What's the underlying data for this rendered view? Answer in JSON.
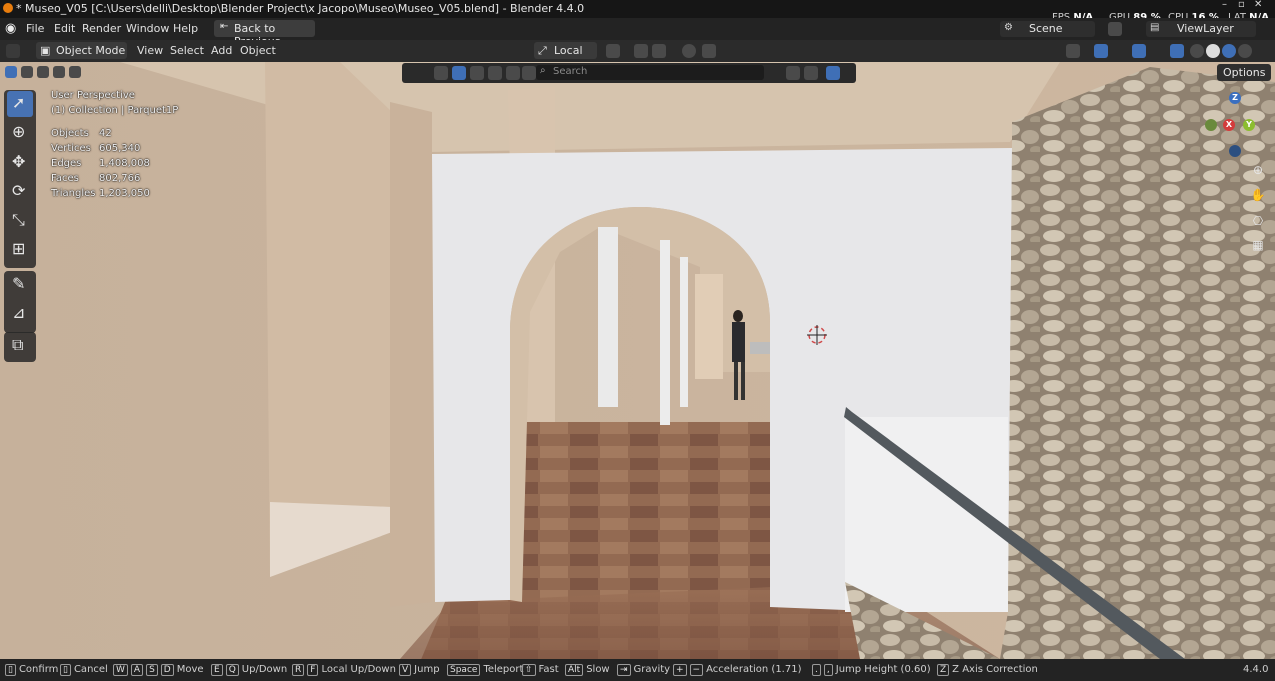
{
  "window": {
    "title": "* Museo_V05 [C:\\Users\\delli\\Desktop\\Blender Project\\x Jacopo\\Museo\\Museo_V05.blend] - Blender 4.4.0",
    "fps_label": "FPS",
    "fps_value": "N/A",
    "gpu_label": "GPU",
    "gpu_value": "89 %",
    "cpu_label": "CPU",
    "cpu_value": "16 %",
    "lat_label": "LAT",
    "lat_value": "N/A"
  },
  "menu": {
    "items": [
      "File",
      "Edit",
      "Render",
      "Window",
      "Help"
    ],
    "back_button": "Back to Previous",
    "scene": "Scene",
    "view_layer": "ViewLayer"
  },
  "header": {
    "mode": "Object Mode",
    "items": [
      "View",
      "Select",
      "Add",
      "Object"
    ],
    "transform_orientation": "Local",
    "search_placeholder": "Search",
    "options": "Options"
  },
  "viewport": {
    "perspective": "User Perspective",
    "collection": "(1) Collection | Parquet1P",
    "stats": [
      {
        "label": "Objects",
        "value": "42"
      },
      {
        "label": "Vertices",
        "value": "605,340"
      },
      {
        "label": "Edges",
        "value": "1,408,008"
      },
      {
        "label": "Faces",
        "value": "802,766"
      },
      {
        "label": "Triangles",
        "value": "1,203,050"
      }
    ],
    "gizmo": {
      "z": "Z",
      "x": "X",
      "y": "Y"
    }
  },
  "status": {
    "confirm": "Confirm",
    "cancel": "Cancel",
    "move": "Move",
    "updown": "Up/Down",
    "local_updown": "Local Up/Down",
    "jump": "Jump",
    "teleport": "Teleport",
    "fast": "Fast",
    "slow": "Slow",
    "gravity": "Gravity",
    "acceleration": "Acceleration (1.71)",
    "jump_height": "Jump Height (0.60)",
    "z_axis": "Z Axis Correction",
    "version": "4.4.0",
    "keys": {
      "w": "W",
      "a": "A",
      "s": "S",
      "d": "D",
      "e": "E",
      "q": "Q",
      "r": "R",
      "f": "F",
      "v": "V",
      "space": "Space",
      "alt": "Alt",
      "z": "Z"
    }
  }
}
